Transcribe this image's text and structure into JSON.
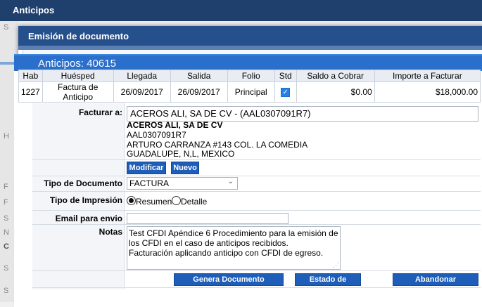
{
  "window": {
    "title": "Anticipos"
  },
  "background_left": {
    "letters": [
      "S",
      "H",
      "F",
      "F",
      "S",
      "N",
      "C",
      "S",
      "S"
    ]
  },
  "modal": {
    "title": "Emisión de documento"
  },
  "panel": {
    "title": "Anticipos: 40615"
  },
  "table": {
    "headers": [
      "Hab",
      "Huésped",
      "Llegada",
      "Salida",
      "Folio",
      "Std",
      "Saldo a Cobrar",
      "Importe a Facturar"
    ],
    "row": {
      "hab": "1227",
      "huesped": "Factura de Anticipo",
      "llegada": "26/09/2017",
      "salida": "26/09/2017",
      "folio": "Principal",
      "std_checked": true,
      "saldo": "$0.00",
      "importe": "$18,000.00"
    }
  },
  "form": {
    "facturar_label": "Facturar a:",
    "facturar_value": "ACEROS ALI, SA DE CV - (AAL0307091R7)",
    "client": {
      "name": "ACEROS ALI, SA DE CV",
      "rfc": "AAL0307091R7",
      "address1": "ARTURO CARRANZA #143 COL. LA COMEDIA",
      "address2": "GUADALUPE, N,L, MEXICO"
    },
    "modificar_label": "Modificar",
    "nuevo_label": "Nuevo",
    "tipo_doc_label": "Tipo de Documento",
    "tipo_doc_value": "FACTURA",
    "tipo_imp_label": "Tipo de Impresión",
    "resumen_label": "Resumen",
    "detalle_label": "Detalle",
    "resumen_selected": true,
    "email_label": "Email para envio",
    "email_value": "",
    "notas_label": "Notas",
    "notas_lines": [
      "Test CFDI Apéndice 6 Procedimiento para la emisión de",
      "los CFDI en el caso de anticipos recibidos.",
      "Facturación aplicando anticipo con CFDI de egreso."
    ]
  },
  "actions": {
    "genera_label": "Genera Documento Electrónico",
    "estado_label": "Estado de Cuenta",
    "abandonar_label": "Abandonar Facturación"
  }
}
